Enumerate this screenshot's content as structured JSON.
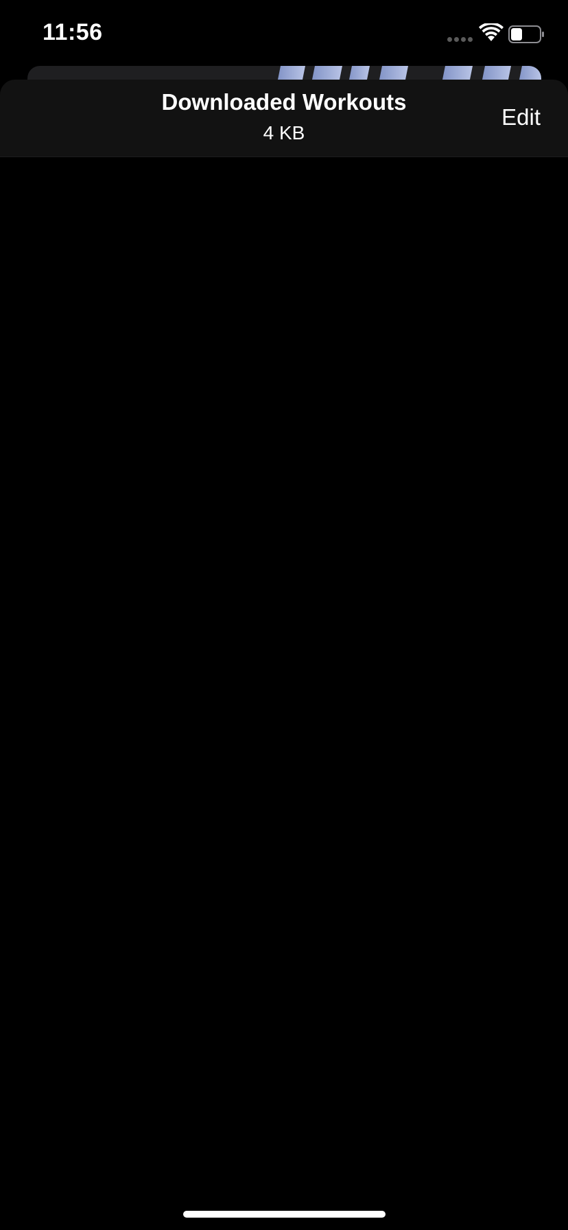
{
  "status_bar": {
    "time": "11:56",
    "signal_icon": "cellular-signal-icon",
    "wifi_icon": "wifi-icon",
    "battery_icon": "battery-icon",
    "battery_level": 0.4
  },
  "nav": {
    "title": "Downloaded Workouts",
    "subtitle": "4 KB",
    "edit_label": "Edit"
  },
  "colors": {
    "background": "#000000",
    "nav_background": "#121212",
    "text": "#ffffff",
    "card_art": "#8aa0d8"
  }
}
